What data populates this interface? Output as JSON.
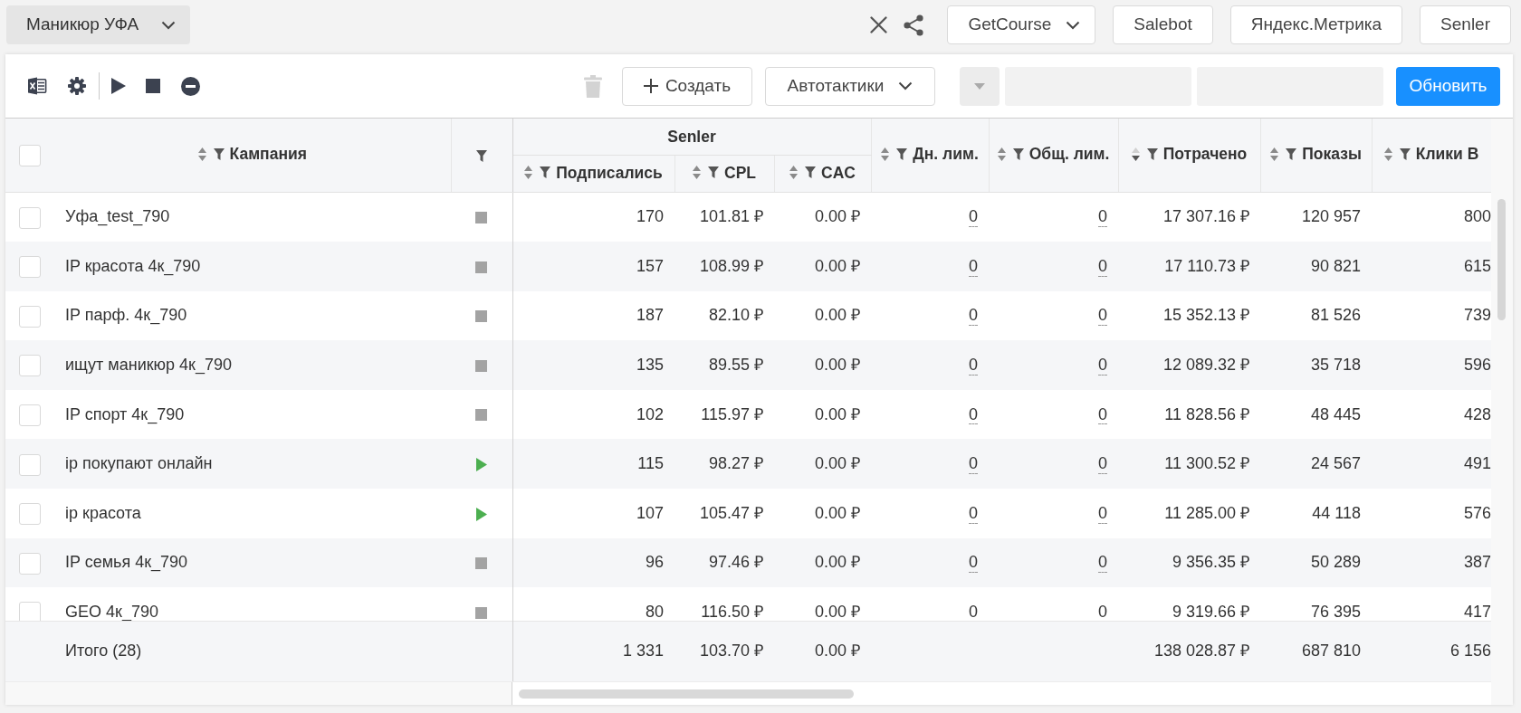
{
  "top_bar": {
    "project": "Маникюр УФА",
    "integrations": [
      {
        "label": "GetCourse",
        "dropdown": true
      },
      {
        "label": "Salebot",
        "dropdown": false
      },
      {
        "label": "Яндекс.Метрика",
        "dropdown": false
      },
      {
        "label": "Senler",
        "dropdown": false
      }
    ]
  },
  "toolbar": {
    "delete_disabled": true,
    "create_label": "Создать",
    "autotactics_label": "Автотактики",
    "period_select_disabled": true,
    "date_fields": [
      {
        "disabled": true
      },
      {
        "disabled": true
      }
    ],
    "refresh_label": "Обновить"
  },
  "table": {
    "all_checked": false,
    "name_column": {
      "label": "Кампания",
      "sort_desc": false
    },
    "columns": [
      {
        "label": "Senler",
        "children": [
          {
            "label": "Подписались",
            "sort_desc": false,
            "kind": "number",
            "total": "1 331"
          },
          {
            "label": "CPL",
            "sort_desc": false,
            "kind": "number",
            "total": "103.70 ₽"
          },
          {
            "label": "CAC",
            "sort_desc": false,
            "kind": "number",
            "total": "0.00 ₽"
          }
        ]
      },
      {
        "label": "Дн. лим.",
        "sort_desc": false,
        "kind": "editable"
      },
      {
        "label": "Общ. лим.",
        "sort_desc": false,
        "kind": "editable"
      },
      {
        "label": "Потрачено",
        "sort_desc": true,
        "kind": "number",
        "total": "138 028.87 ₽"
      },
      {
        "label": "Показы",
        "sort_desc": false,
        "kind": "number",
        "total": "687 810"
      },
      {
        "label": "Клики В",
        "sort_desc": false,
        "kind": "number",
        "total": "6 156"
      }
    ],
    "rows": [
      {
        "checked": false,
        "name": "Уфа_test_790",
        "running": false,
        "values": [
          "170",
          "101.81 ₽",
          "0.00 ₽",
          "0",
          "0",
          "17 307.16 ₽",
          "120 957",
          "800"
        ]
      },
      {
        "checked": false,
        "name": "IP красота 4к_790",
        "running": false,
        "values": [
          "157",
          "108.99 ₽",
          "0.00 ₽",
          "0",
          "0",
          "17 110.73 ₽",
          "90 821",
          "615"
        ]
      },
      {
        "checked": false,
        "name": "IP парф. 4к_790",
        "running": false,
        "values": [
          "187",
          "82.10 ₽",
          "0.00 ₽",
          "0",
          "0",
          "15 352.13 ₽",
          "81 526",
          "739"
        ]
      },
      {
        "checked": false,
        "name": "ищут маникюр 4к_790",
        "running": false,
        "values": [
          "135",
          "89.55 ₽",
          "0.00 ₽",
          "0",
          "0",
          "12 089.32 ₽",
          "35 718",
          "596"
        ]
      },
      {
        "checked": false,
        "name": "IP спорт 4к_790",
        "running": false,
        "values": [
          "102",
          "115.97 ₽",
          "0.00 ₽",
          "0",
          "0",
          "11 828.56 ₽",
          "48 445",
          "428"
        ]
      },
      {
        "checked": false,
        "name": "ip покупают онлайн",
        "running": true,
        "values": [
          "115",
          "98.27 ₽",
          "0.00 ₽",
          "0",
          "0",
          "11 300.52 ₽",
          "24 567",
          "491"
        ]
      },
      {
        "checked": false,
        "name": "ip красота",
        "running": true,
        "values": [
          "107",
          "105.47 ₽",
          "0.00 ₽",
          "0",
          "0",
          "11 285.00 ₽",
          "44 118",
          "576"
        ]
      },
      {
        "checked": false,
        "name": "IP семья 4к_790",
        "running": false,
        "values": [
          "96",
          "97.46 ₽",
          "0.00 ₽",
          "0",
          "0",
          "9 356.35 ₽",
          "50 289",
          "387"
        ]
      },
      {
        "checked": false,
        "name": "GEO 4к_790",
        "running": false,
        "values": [
          "80",
          "116.50 ₽",
          "0.00 ₽",
          "0",
          "0",
          "9 319.66 ₽",
          "76 395",
          "417"
        ]
      }
    ],
    "totals": {
      "label": "Итого (28)"
    }
  }
}
